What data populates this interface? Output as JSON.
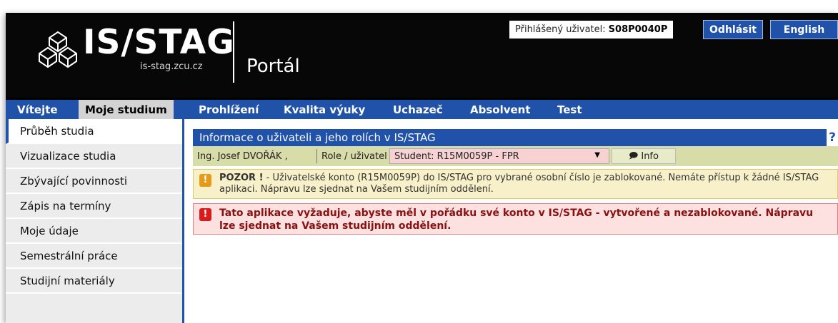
{
  "header": {
    "logo_text": "IS/STAG",
    "logo_domain": "is-stag.zcu.cz",
    "portal_label": "Portál",
    "user_label": "Přihlášený uživatel:",
    "user_id": "S08P0040P",
    "logout_label": "Odhlásit",
    "english_label": "English"
  },
  "nav": {
    "tabs": [
      {
        "label": "Vítejte"
      },
      {
        "label": "Moje studium"
      },
      {
        "label": "Prohlížení"
      },
      {
        "label": "Kvalita výuky"
      },
      {
        "label": "Uchazeč"
      },
      {
        "label": "Absolvent"
      },
      {
        "label": "Test"
      }
    ]
  },
  "sidebar": {
    "items": [
      {
        "label": "Průběh studia"
      },
      {
        "label": "Vizualizace studia"
      },
      {
        "label": "Zbývající povinnosti"
      },
      {
        "label": "Zápis na termíny"
      },
      {
        "label": "Moje údaje"
      },
      {
        "label": "Semestrální práce"
      },
      {
        "label": "Studijní materiály"
      }
    ]
  },
  "content": {
    "panel_title": "Informace o uživateli a jeho rolích v IS/STAG",
    "help_label": "?",
    "user_name": "Ing. Josef DVOŘÁK ,",
    "role_label": "Role / uživatel",
    "role_value": "Student: R15M0059P - FPR",
    "info_label": "Info",
    "warning": {
      "strong": "POZOR !",
      "text": " - Uživatelské konto (R15M0059P) do IS/STAG pro vybrané osobní číslo je zablokované. Nemáte přístup k žádné IS/STAG aplikaci. Nápravu lze sjednat na Vašem studijním oddělení."
    },
    "error": {
      "text": "Tato aplikace vyžaduje, abyste měl v pořádku své konto v IS/STAG - vytvořené a nezablokované. Nápravu lze sjednat na Vašem studijním oddělení."
    }
  }
}
